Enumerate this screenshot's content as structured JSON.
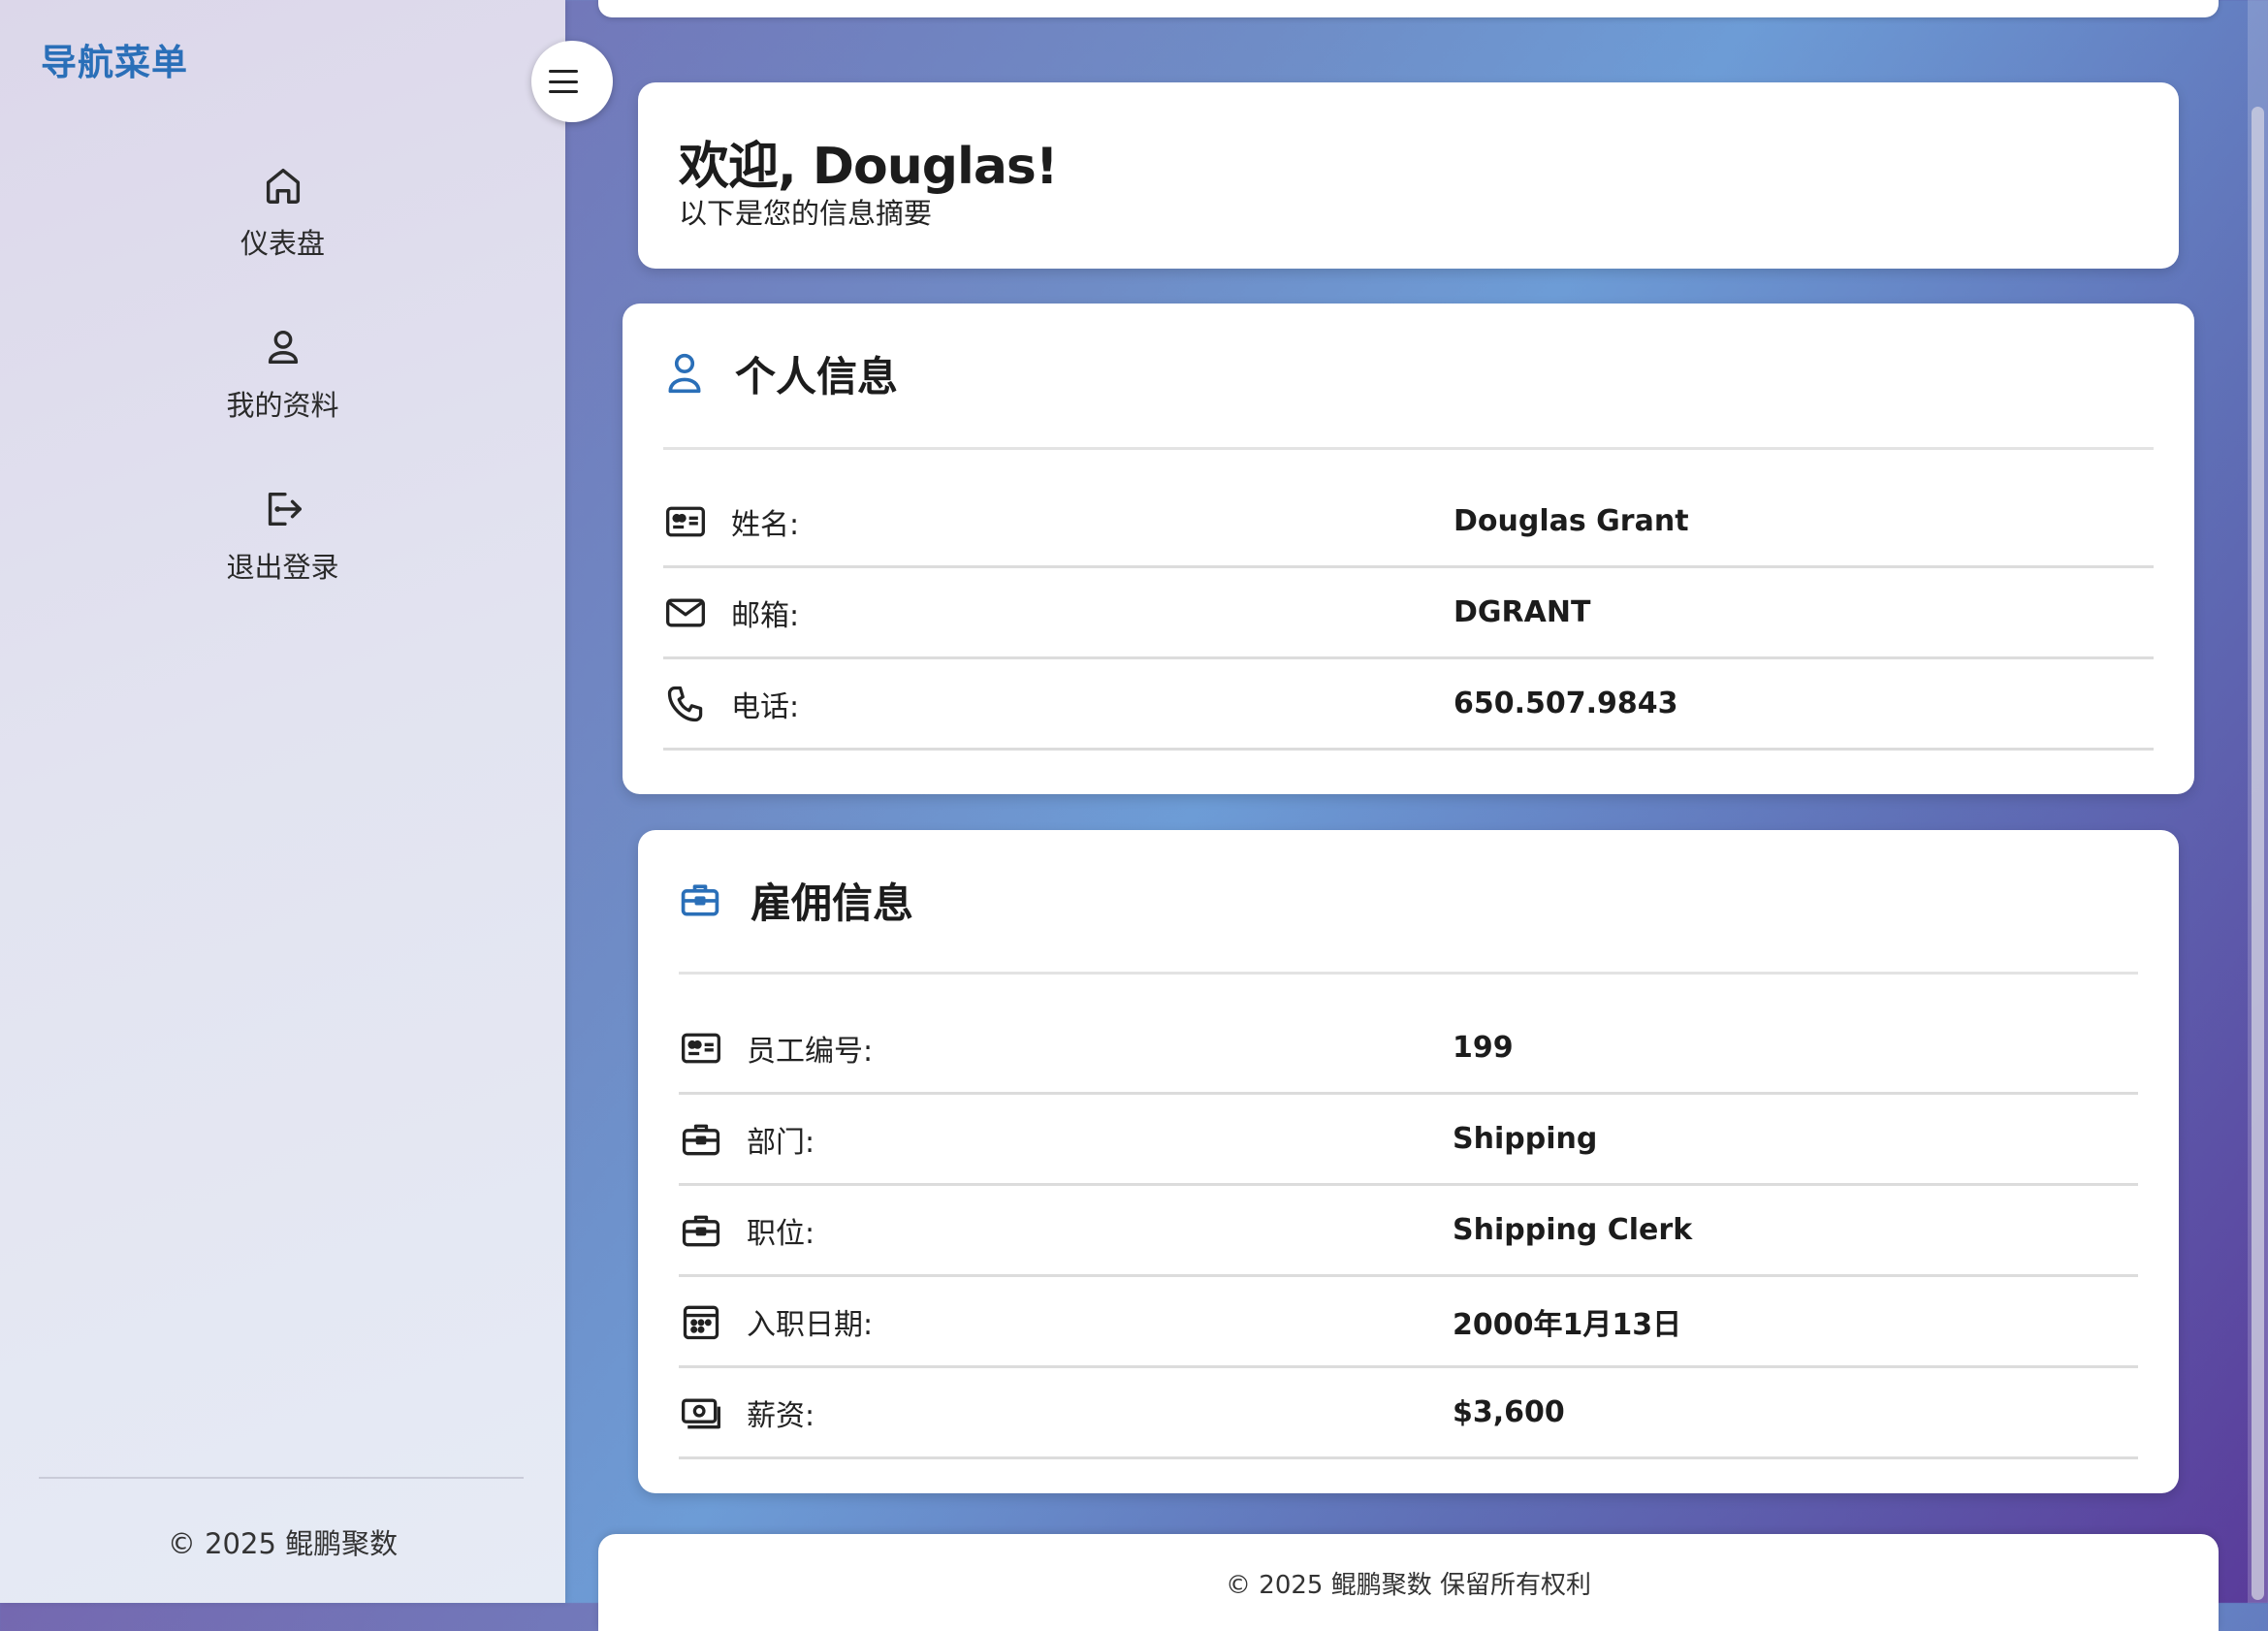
{
  "sidebar": {
    "brand": "导航菜单",
    "items": [
      {
        "label": "仪表盘",
        "icon": "home-icon"
      },
      {
        "label": "我的资料",
        "icon": "user-icon"
      },
      {
        "label": "退出登录",
        "icon": "logout-icon"
      }
    ],
    "copyright": "© 2025 鲲鹏聚数",
    "toggle_icon": "menu-icon"
  },
  "welcome": {
    "title": "欢迎, Douglas!",
    "subtitle": "以下是您的信息摘要"
  },
  "personal": {
    "title": "个人信息",
    "icon": "user-icon",
    "rows": [
      {
        "icon": "id-card-icon",
        "label": "姓名:",
        "value": "Douglas Grant"
      },
      {
        "icon": "mail-icon",
        "label": "邮箱:",
        "value": "DGRANT"
      },
      {
        "icon": "phone-icon",
        "label": "电话:",
        "value": "650.507.9843"
      }
    ]
  },
  "employment": {
    "title": "雇佣信息",
    "icon": "briefcase-icon",
    "rows": [
      {
        "icon": "id-card-icon",
        "label": "员工编号:",
        "value": "199"
      },
      {
        "icon": "briefcase-icon",
        "label": "部门:",
        "value": "Shipping"
      },
      {
        "icon": "briefcase-icon",
        "label": "职位:",
        "value": "Shipping Clerk"
      },
      {
        "icon": "calendar-icon",
        "label": "入职日期:",
        "value": "2000年1月13日"
      },
      {
        "icon": "money-icon",
        "label": "薪资:",
        "value": "$3,600"
      }
    ]
  },
  "footer": {
    "text": "© 2025 鲲鹏聚数 保留所有权利"
  },
  "colors": {
    "accent": "#2a6fb8",
    "text": "#1c1c1c"
  }
}
